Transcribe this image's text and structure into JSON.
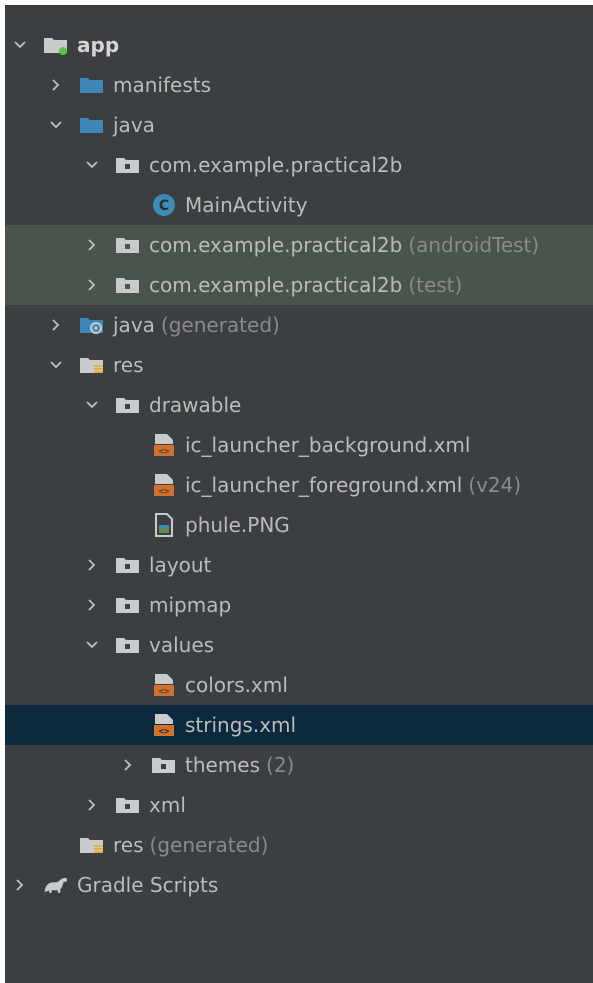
{
  "colors": {
    "panel_bg": "#3c3f41",
    "text": "#bbbbbb",
    "suffix": "#8a8a8a",
    "test_row_bg": "#49544a",
    "selected_row_bg": "#0d293e",
    "folder_blue": "#3d88b8",
    "folder_grey": "#c9cbcd",
    "class_circle": "#3d8bb6",
    "xml_orange": "#d4712c",
    "module_dot": "#58c44a"
  },
  "tree": {
    "items": [
      {
        "label": "app",
        "suffix": "",
        "icon": "module-folder-icon",
        "expand": "expanded"
      },
      {
        "label": "manifests",
        "suffix": "",
        "icon": "folder-blue-icon",
        "expand": "collapsed"
      },
      {
        "label": "java",
        "suffix": "",
        "icon": "folder-blue-icon",
        "expand": "expanded"
      },
      {
        "label": "com.example.practical2b",
        "suffix": "",
        "icon": "package-icon",
        "expand": "expanded"
      },
      {
        "label": "MainActivity",
        "suffix": "",
        "icon": "class-icon",
        "expand": "none"
      },
      {
        "label": "com.example.practical2b",
        "suffix": "(androidTest)",
        "icon": "package-icon",
        "expand": "collapsed"
      },
      {
        "label": "com.example.practical2b",
        "suffix": "(test)",
        "icon": "package-icon",
        "expand": "collapsed"
      },
      {
        "label": "java",
        "suffix": "(generated)",
        "icon": "generated-folder-icon",
        "expand": "collapsed"
      },
      {
        "label": "res",
        "suffix": "",
        "icon": "res-folder-icon",
        "expand": "expanded"
      },
      {
        "label": "drawable",
        "suffix": "",
        "icon": "package-icon",
        "expand": "expanded"
      },
      {
        "label": "ic_launcher_background.xml",
        "suffix": "",
        "icon": "xml-file-icon",
        "expand": "none"
      },
      {
        "label": "ic_launcher_foreground.xml",
        "suffix": "(v24)",
        "icon": "xml-file-icon",
        "expand": "none"
      },
      {
        "label": "phule.PNG",
        "suffix": "",
        "icon": "image-file-icon",
        "expand": "none"
      },
      {
        "label": "layout",
        "suffix": "",
        "icon": "package-icon",
        "expand": "collapsed"
      },
      {
        "label": "mipmap",
        "suffix": "",
        "icon": "package-icon",
        "expand": "collapsed"
      },
      {
        "label": "values",
        "suffix": "",
        "icon": "package-icon",
        "expand": "expanded"
      },
      {
        "label": "colors.xml",
        "suffix": "",
        "icon": "xml-file-icon",
        "expand": "none"
      },
      {
        "label": "strings.xml",
        "suffix": "",
        "icon": "xml-file-icon",
        "expand": "none"
      },
      {
        "label": "themes",
        "suffix": "(2)",
        "icon": "package-icon",
        "expand": "collapsed"
      },
      {
        "label": "xml",
        "suffix": "",
        "icon": "package-icon",
        "expand": "collapsed"
      },
      {
        "label": "res",
        "suffix": "(generated)",
        "icon": "res-folder-icon",
        "expand": "none"
      },
      {
        "label": "Gradle Scripts",
        "suffix": "",
        "icon": "gradle-icon",
        "expand": "collapsed"
      }
    ]
  }
}
